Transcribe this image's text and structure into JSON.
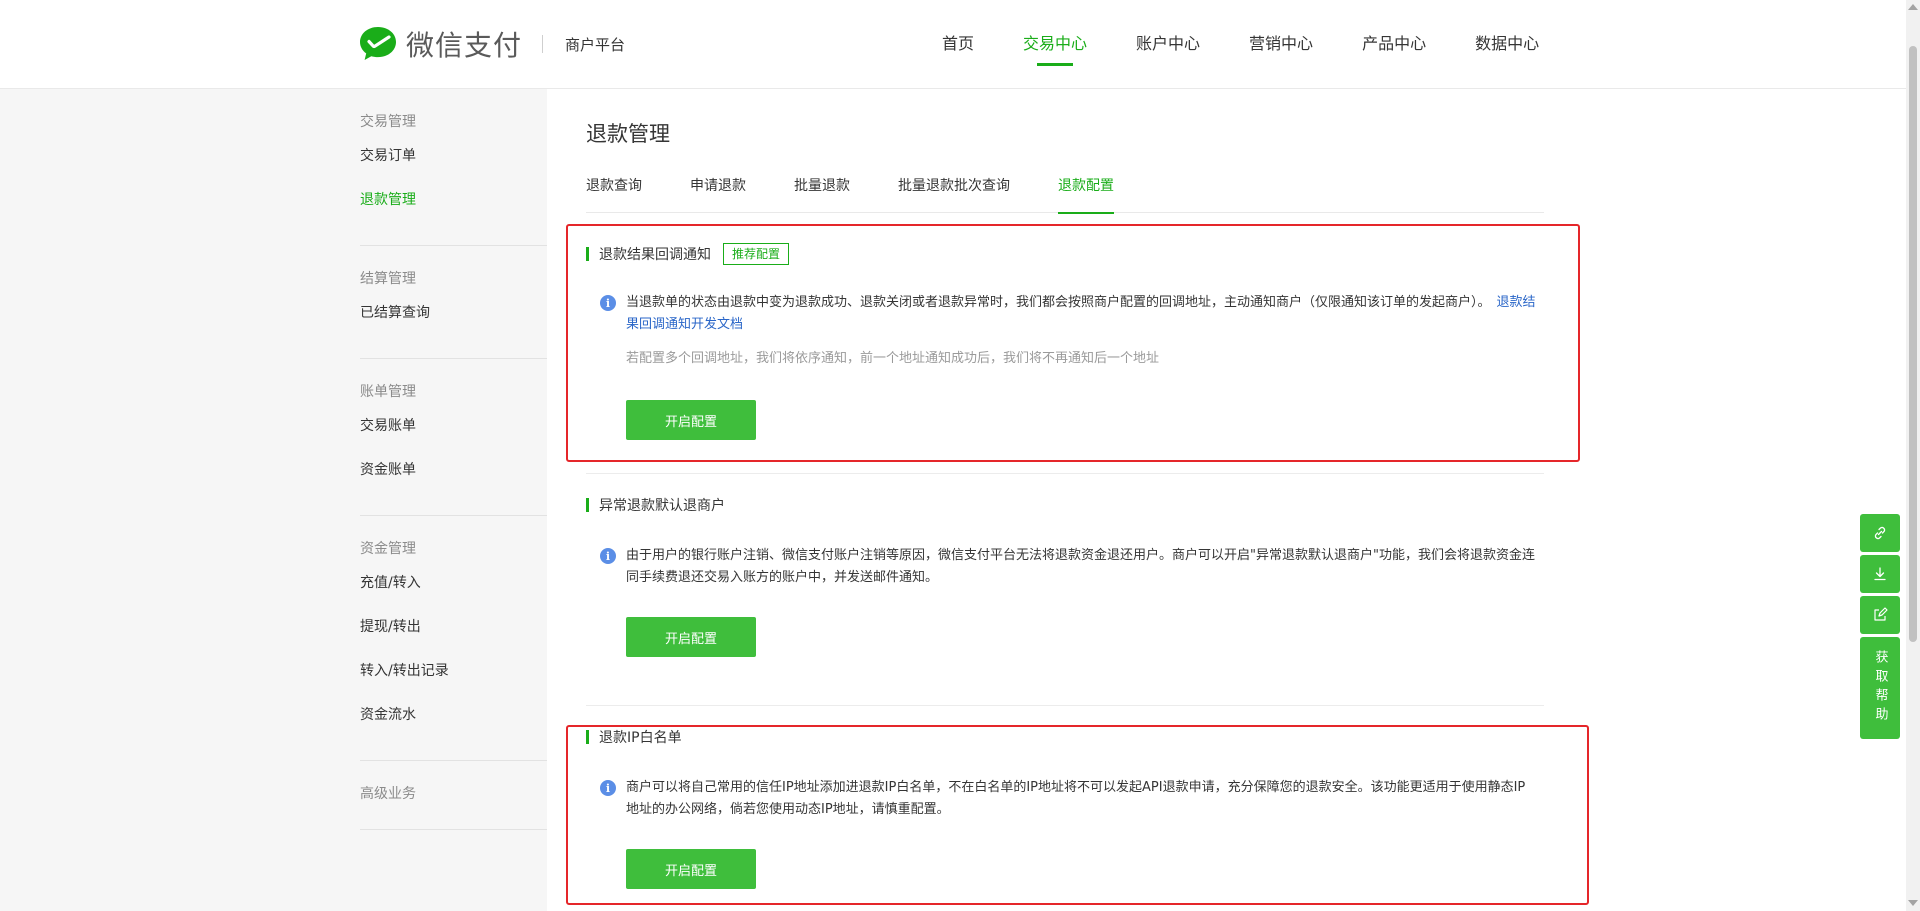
{
  "brand": {
    "name": "微信支付",
    "subtitle": "商户平台",
    "logo_icon": "wechat-pay-logo-icon"
  },
  "mainnav": {
    "items": [
      {
        "label": "首页"
      },
      {
        "label": "交易中心",
        "active": true
      },
      {
        "label": "账户中心"
      },
      {
        "label": "营销中心"
      },
      {
        "label": "产品中心"
      },
      {
        "label": "数据中心"
      }
    ]
  },
  "sidebar": {
    "groups": [
      {
        "title": "交易管理",
        "items": [
          "交易订单",
          "退款管理"
        ]
      },
      {
        "title": "结算管理",
        "items": [
          "已结算查询"
        ]
      },
      {
        "title": "账单管理",
        "items": [
          "交易账单",
          "资金账单"
        ]
      },
      {
        "title": "资金管理",
        "items": [
          "充值/转入",
          "提现/转出",
          "转入/转出记录",
          "资金流水"
        ]
      },
      {
        "title": "高级业务",
        "items": []
      }
    ]
  },
  "page": {
    "title": "退款管理",
    "subtabs": [
      "退款查询",
      "申请退款",
      "批量退款",
      "批量退款批次查询",
      "退款配置"
    ]
  },
  "sections": {
    "s0": {
      "title": "退款结果回调通知",
      "badge": "推荐配置",
      "text": "当退款单的状态由退款中变为退款成功、退款关闭或者退款异常时，我们都会按照商户配置的回调地址，主动通知商户（仅限通知该订单的发起商户）。",
      "link": "退款结果回调通知开发文档",
      "hint": "若配置多个回调地址，我们将依序通知，前一个地址通知成功后，我们将不再通知后一个地址",
      "button": "开启配置"
    },
    "s1": {
      "title": "异常退款默认退商户",
      "text": "由于用户的银行账户注销、微信支付账户注销等原因，微信支付平台无法将退款资金退还用户。商户可以开启\"异常退款默认退商户\"功能，我们会将退款资金连同手续费退还交易入账方的账户中，并发送邮件通知。",
      "button": "开启配置"
    },
    "s2": {
      "title": "退款IP白名单",
      "text": "商户可以将自己常用的信任IP地址添加进退款IP白名单，不在白名单的IP地址将不可以发起API退款申请，充分保障您的退款安全。该功能更适用于使用静态IP地址的办公网络，倘若您使用动态IP地址，请慎重配置。",
      "button": "开启配置"
    }
  },
  "floatbar": {
    "icons": [
      "link-icon",
      "download-icon",
      "edit-icon"
    ],
    "help_label": "获取帮助"
  },
  "colors": {
    "accent": "#1aad19",
    "button": "#3fbe3c",
    "link": "#2a66c8",
    "highlight": "#e5262a"
  }
}
